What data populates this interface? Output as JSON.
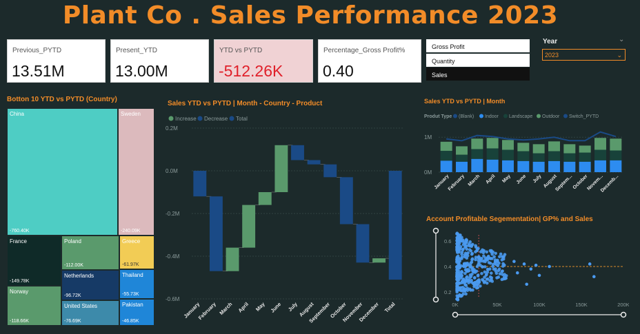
{
  "title": "Plant Co . Sales Performance 2023",
  "kpis": [
    {
      "label": "Previous_PYTD",
      "value": "13.51M"
    },
    {
      "label": "Present_YTD",
      "value": "13.00M"
    },
    {
      "label": "YTD vs PYTD",
      "value": "-512.26K"
    },
    {
      "label": "Percentage_Gross Profit%",
      "value": "0.40"
    }
  ],
  "colors": {
    "accent": "#f28c28",
    "negative": "#e0202a",
    "negative_bg": "#f0d2d4",
    "increase": "#5a9a6c",
    "decrease": "#1a4a86",
    "indoor": "#2d8cf0"
  },
  "slicer": {
    "items": [
      "Gross Profit",
      "Quantity",
      "Sales"
    ],
    "selected": "Sales"
  },
  "year_filter": {
    "label": "Year",
    "value": "2023"
  },
  "treemap": {
    "title": "Botton 10 YTD vs PYTD (Country)",
    "items": [
      {
        "name": "China",
        "value": "-760.40K",
        "color": "#4ecdc4"
      },
      {
        "name": "Sweden",
        "value": "-240.09K",
        "color": "#dcbabd"
      },
      {
        "name": "France",
        "value": "-149.78K",
        "color": "#0f2a28"
      },
      {
        "name": "Poland",
        "value": "-112.00K",
        "color": "#5a9a6c"
      },
      {
        "name": "Greece",
        "value": "-61.97K",
        "color": "#f2cc55"
      },
      {
        "name": "Norway",
        "value": "-118.66K",
        "color": "#5a9a6c"
      },
      {
        "name": "Netherlands",
        "value": "-96.72K",
        "color": "#163a66"
      },
      {
        "name": "Thailand",
        "value": "-55.73K",
        "color": "#1f86d8"
      },
      {
        "name": "United States",
        "value": "-76.69K",
        "color": "#3d8aaa"
      },
      {
        "name": "Pakistan",
        "value": "-46.85K",
        "color": "#1f86d8"
      }
    ]
  },
  "chart_data": [
    {
      "type": "waterfall",
      "title": "Sales YTD vs PYTD | Month - Country - Product",
      "legend": [
        "Increase",
        "Decrease",
        "Total"
      ],
      "categories": [
        "January",
        "February",
        "March",
        "April",
        "May",
        "June",
        "July",
        "August",
        "September",
        "October",
        "November",
        "December",
        "Total"
      ],
      "values": [
        -0.12,
        -0.35,
        0.11,
        0.2,
        0.06,
        0.22,
        -0.07,
        -0.02,
        -0.06,
        -0.22,
        -0.18,
        0.02,
        -0.51
      ],
      "y_ticks": [
        "0.2M",
        "0.0M",
        "-0.2M",
        "-0.4M",
        "-0.6M"
      ],
      "ylim": [
        -0.6,
        0.2
      ]
    },
    {
      "type": "bar",
      "stacked": true,
      "title": "Sales YTD vs PYTD | Month",
      "legend_title": "Produt Type",
      "legend": [
        "(Blank)",
        "Indoor",
        "Landscape",
        "Outdoor",
        "Switch_PYTD"
      ],
      "categories": [
        "January",
        "February",
        "March",
        "April",
        "May",
        "June",
        "July",
        "August",
        "Septem...",
        "October",
        "Novem...",
        "Decemb..."
      ],
      "series": [
        {
          "name": "Indoor",
          "values": [
            0.33,
            0.3,
            0.38,
            0.36,
            0.34,
            0.32,
            0.3,
            0.32,
            0.3,
            0.3,
            0.34,
            0.34
          ]
        },
        {
          "name": "Landscape",
          "values": [
            0.28,
            0.2,
            0.28,
            0.32,
            0.3,
            0.28,
            0.24,
            0.28,
            0.24,
            0.26,
            0.3,
            0.28
          ]
        },
        {
          "name": "Outdoor",
          "values": [
            0.26,
            0.24,
            0.3,
            0.3,
            0.28,
            0.24,
            0.26,
            0.28,
            0.26,
            0.2,
            0.34,
            0.34
          ]
        },
        {
          "name": "Switch_PYTD",
          "values": [
            0.95,
            0.9,
            1.05,
            1.02,
            0.95,
            0.92,
            0.95,
            1.0,
            0.9,
            0.9,
            1.15,
            1.02
          ]
        }
      ],
      "y_ticks": [
        "1M",
        "0M"
      ],
      "ylim": [
        0,
        1.3
      ]
    },
    {
      "type": "scatter",
      "title": "Account Profitable Segementation| GP% and Sales",
      "x_ticks": [
        "0K",
        "50K",
        "100K",
        "150K",
        "200K"
      ],
      "y_ticks": [
        "0.6",
        "0.4",
        "0.2"
      ],
      "xlim": [
        0,
        200
      ],
      "ylim": [
        0.15,
        0.65
      ],
      "average_line": 0.4
    }
  ]
}
